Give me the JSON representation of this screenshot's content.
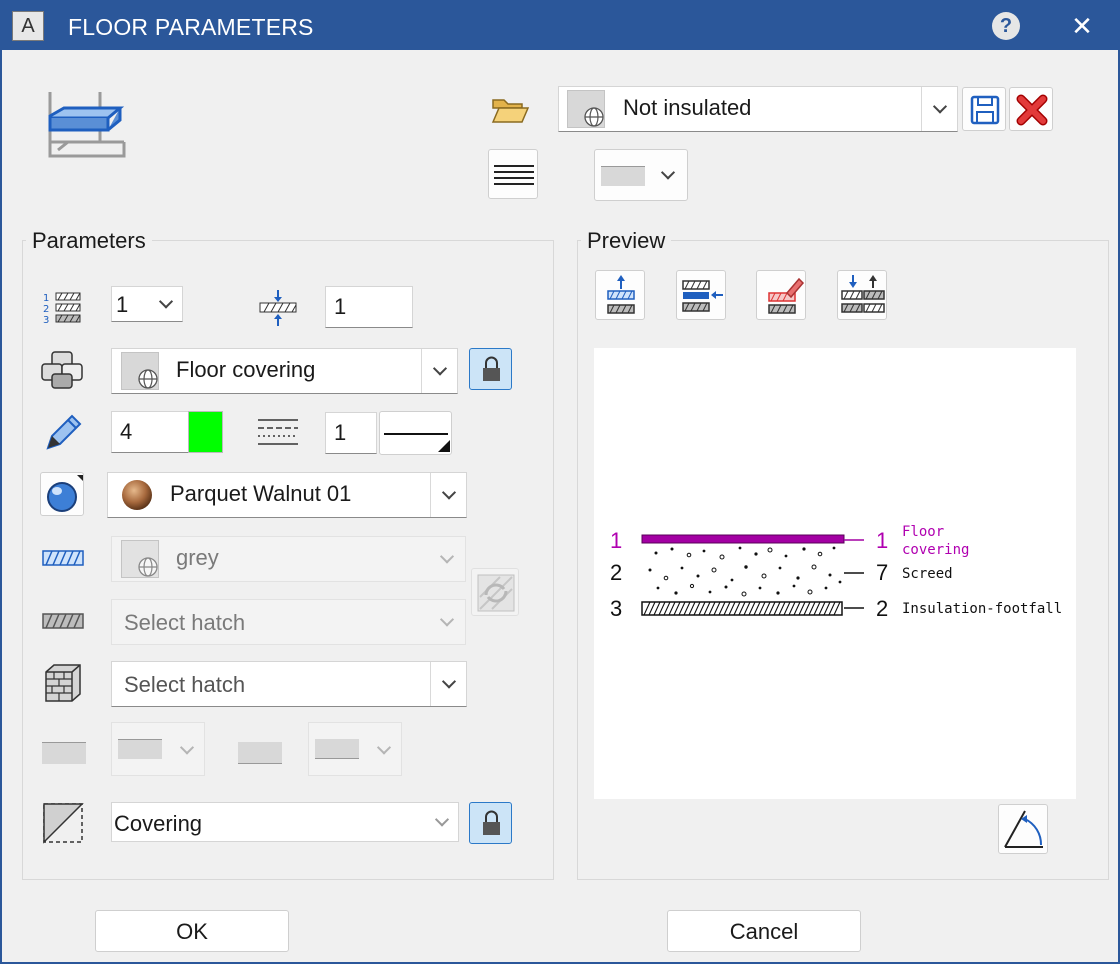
{
  "window": {
    "title": "FLOOR PARAMETERS",
    "app_icon_letter": "A",
    "help_label": "?",
    "close_label": "✕"
  },
  "header": {
    "preset_value": "Not insulated",
    "line_dropdown_icon": "line-style-icon"
  },
  "parameters": {
    "group_label": "Parameters",
    "layer_count": "1",
    "thickness": "1",
    "component_value": "Floor covering",
    "pen_number": "4",
    "pen_color": "#00ff00",
    "line_number": "1",
    "surface_value": "Parquet Walnut 01",
    "hatch_color_value": "grey",
    "hatch_pattern_value": "Select hatch",
    "section_hatch_value": "Select hatch",
    "type_value": "Covering"
  },
  "preview": {
    "group_label": "Preview",
    "layers": [
      {
        "left_num": "1",
        "right_num": "1",
        "label_line1": "Floor",
        "label_line2": "covering",
        "color": "#b000b0"
      },
      {
        "left_num": "2",
        "right_num": "7",
        "label_line1": "Screed",
        "label_line2": "",
        "color": "#000000"
      },
      {
        "left_num": "3",
        "right_num": "2",
        "label_line1": "Insulation-footfall",
        "label_line2": "",
        "color": "#000000"
      }
    ]
  },
  "footer": {
    "ok_label": "OK",
    "cancel_label": "Cancel"
  }
}
